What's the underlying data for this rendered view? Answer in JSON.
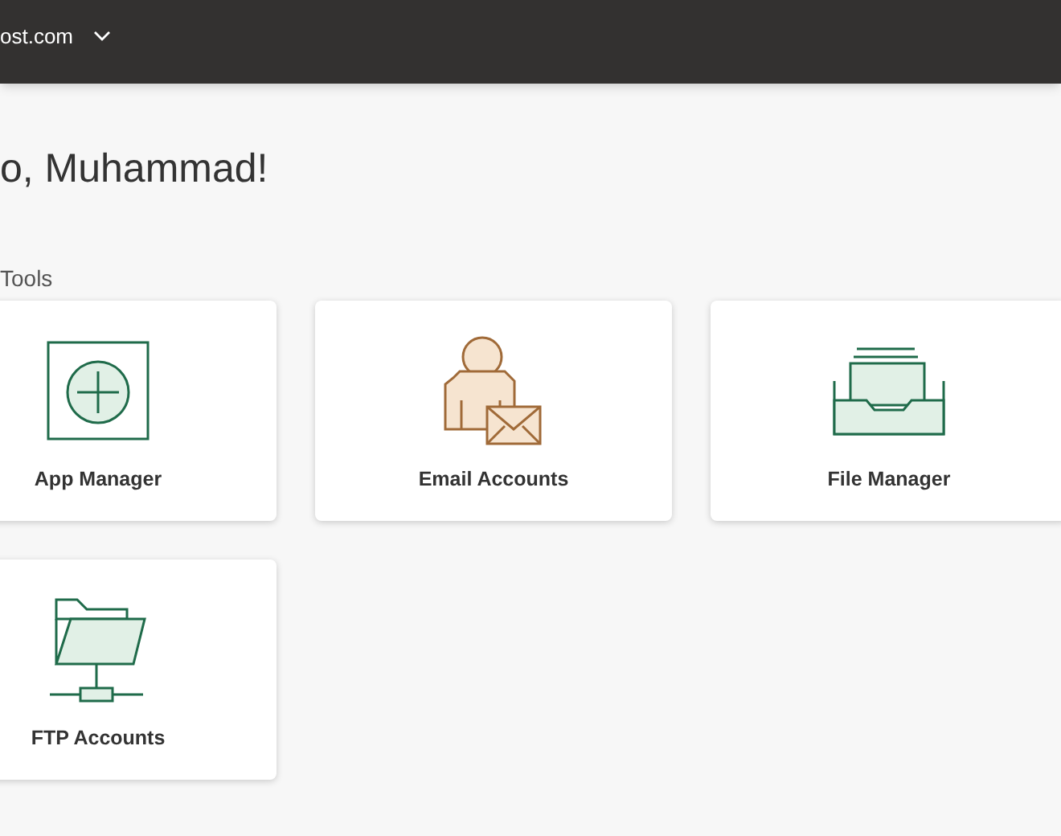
{
  "header": {
    "domain": "ost.com"
  },
  "greeting": "o, Muhammad!",
  "section_title": "Tools",
  "tools": [
    {
      "kind": "apps",
      "label": "App Manager"
    },
    {
      "kind": "email",
      "label": "Email Accounts"
    },
    {
      "kind": "files",
      "label": "File Manager"
    },
    {
      "kind": "ftp",
      "label": "FTP Accounts"
    }
  ]
}
